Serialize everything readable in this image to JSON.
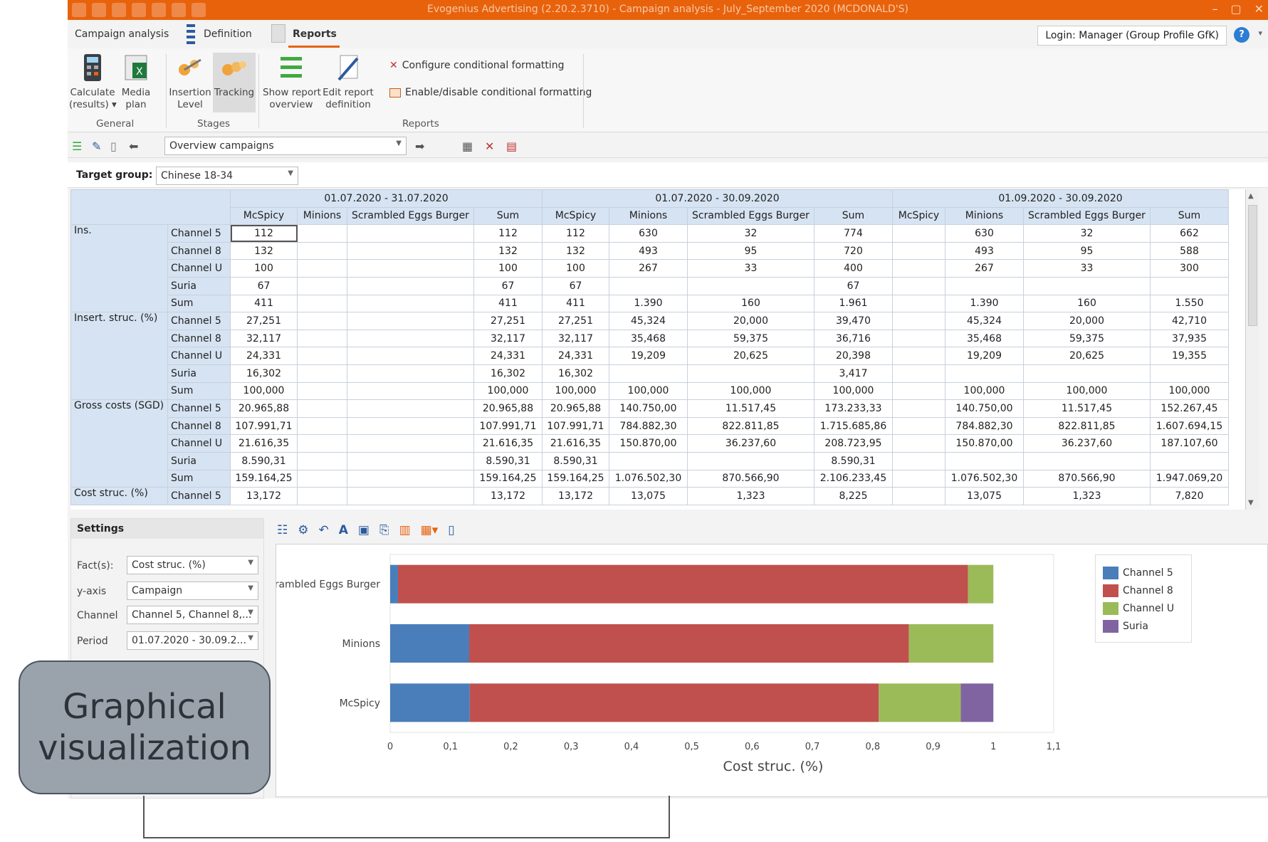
{
  "window": {
    "title": "Evogenius Advertising (2.20.2.3710) - Campaign analysis - July_September 2020 (MCDONALD'S)",
    "buttons": [
      "–",
      "▢",
      "✕"
    ]
  },
  "tabs": [
    {
      "label": "Campaign analysis"
    },
    {
      "label": "Definition"
    },
    {
      "label": "Reports"
    }
  ],
  "login": "Login: Manager (Group Profile GfK)",
  "help": "?",
  "ribbon": {
    "general": {
      "label": "General",
      "calculate": "Calculate\n(results) ▾",
      "media_plan": "Media\nplan"
    },
    "stages": {
      "label": "Stages",
      "insertion": "Insertion\nLevel",
      "tracking": "Tracking"
    },
    "reports": {
      "label": "Reports",
      "show_overview": "Show report\noverview",
      "edit_definition": "Edit report\ndefinition",
      "configure_cf": "Configure conditional formatting",
      "toggle_cf": "Enable/disable conditional formatting"
    }
  },
  "toolbar": {
    "report_select": "Overview campaigns"
  },
  "target_group": {
    "label": "Target group:",
    "value": "Chinese 18-34"
  },
  "grid": {
    "periods": [
      "01.07.2020 - 31.07.2020",
      "01.07.2020 - 30.09.2020",
      "01.09.2020 - 30.09.2020"
    ],
    "columns": [
      "McSpicy",
      "Minions",
      "Scrambled Eggs Burger",
      "Sum"
    ],
    "groups": [
      {
        "name": "Ins.",
        "rows": [
          {
            "ch": "Channel 5",
            "v": [
              "112",
              "",
              "",
              "112",
              "112",
              "630",
              "32",
              "774",
              "",
              "630",
              "32",
              "662"
            ]
          },
          {
            "ch": "Channel 8",
            "v": [
              "132",
              "",
              "",
              "132",
              "132",
              "493",
              "95",
              "720",
              "",
              "493",
              "95",
              "588"
            ]
          },
          {
            "ch": "Channel U",
            "v": [
              "100",
              "",
              "",
              "100",
              "100",
              "267",
              "33",
              "400",
              "",
              "267",
              "33",
              "300"
            ]
          },
          {
            "ch": "Suria",
            "v": [
              "67",
              "",
              "",
              "67",
              "67",
              "",
              "",
              "67",
              "",
              "",
              "",
              ""
            ]
          },
          {
            "ch": "Sum",
            "v": [
              "411",
              "",
              "",
              "411",
              "411",
              "1.390",
              "160",
              "1.961",
              "",
              "1.390",
              "160",
              "1.550"
            ]
          }
        ]
      },
      {
        "name": "Insert. struc. (%)",
        "rows": [
          {
            "ch": "Channel 5",
            "v": [
              "27,251",
              "",
              "",
              "27,251",
              "27,251",
              "45,324",
              "20,000",
              "39,470",
              "",
              "45,324",
              "20,000",
              "42,710"
            ]
          },
          {
            "ch": "Channel 8",
            "v": [
              "32,117",
              "",
              "",
              "32,117",
              "32,117",
              "35,468",
              "59,375",
              "36,716",
              "",
              "35,468",
              "59,375",
              "37,935"
            ]
          },
          {
            "ch": "Channel U",
            "v": [
              "24,331",
              "",
              "",
              "24,331",
              "24,331",
              "19,209",
              "20,625",
              "20,398",
              "",
              "19,209",
              "20,625",
              "19,355"
            ]
          },
          {
            "ch": "Suria",
            "v": [
              "16,302",
              "",
              "",
              "16,302",
              "16,302",
              "",
              "",
              "3,417",
              "",
              "",
              "",
              ""
            ]
          },
          {
            "ch": "Sum",
            "v": [
              "100,000",
              "",
              "",
              "100,000",
              "100,000",
              "100,000",
              "100,000",
              "100,000",
              "",
              "100,000",
              "100,000",
              "100,000"
            ]
          }
        ]
      },
      {
        "name": "Gross costs (SGD)",
        "rows": [
          {
            "ch": "Channel 5",
            "v": [
              "20.965,88",
              "",
              "",
              "20.965,88",
              "20.965,88",
              "140.750,00",
              "11.517,45",
              "173.233,33",
              "",
              "140.750,00",
              "11.517,45",
              "152.267,45"
            ]
          },
          {
            "ch": "Channel 8",
            "v": [
              "107.991,71",
              "",
              "",
              "107.991,71",
              "107.991,71",
              "784.882,30",
              "822.811,85",
              "1.715.685,86",
              "",
              "784.882,30",
              "822.811,85",
              "1.607.694,15"
            ]
          },
          {
            "ch": "Channel U",
            "v": [
              "21.616,35",
              "",
              "",
              "21.616,35",
              "21.616,35",
              "150.870,00",
              "36.237,60",
              "208.723,95",
              "",
              "150.870,00",
              "36.237,60",
              "187.107,60"
            ]
          },
          {
            "ch": "Suria",
            "v": [
              "8.590,31",
              "",
              "",
              "8.590,31",
              "8.590,31",
              "",
              "",
              "8.590,31",
              "",
              "",
              "",
              ""
            ]
          },
          {
            "ch": "Sum",
            "v": [
              "159.164,25",
              "",
              "",
              "159.164,25",
              "159.164,25",
              "1.076.502,30",
              "870.566,90",
              "2.106.233,45",
              "",
              "1.076.502,30",
              "870.566,90",
              "1.947.069,20"
            ]
          }
        ]
      },
      {
        "name": "Cost struc. (%)",
        "rows": [
          {
            "ch": "Channel 5",
            "v": [
              "13,172",
              "",
              "",
              "13,172",
              "13,172",
              "13,075",
              "1,323",
              "8,225",
              "",
              "13,075",
              "1,323",
              "7,820"
            ]
          }
        ]
      }
    ]
  },
  "settings": {
    "title": "Settings",
    "facts_label": "Fact(s):",
    "facts_value": "Cost struc. (%)",
    "yaxis_label": "y-axis",
    "yaxis_value": "Campaign",
    "channel_label": "Channel",
    "channel_value": "Channel 5, Channel 8,...",
    "period_label": "Period",
    "period_value": "01.07.2020 - 30.09.2..."
  },
  "callout": "Graphical visualization",
  "chart_data": {
    "type": "bar",
    "orientation": "horizontal",
    "stacked": true,
    "categories": [
      "Scrambled Eggs Burger",
      "Minions",
      "McSpicy"
    ],
    "series": [
      {
        "name": "Channel 5",
        "color": "#4a7ebb",
        "values": [
          0.013,
          0.131,
          0.132
        ]
      },
      {
        "name": "Channel 8",
        "color": "#c0504d",
        "values": [
          0.945,
          0.729,
          0.678
        ]
      },
      {
        "name": "Channel U",
        "color": "#9bbb59",
        "values": [
          0.042,
          0.14,
          0.136
        ]
      },
      {
        "name": "Suria",
        "color": "#8064a2",
        "values": [
          0,
          0,
          0.054
        ]
      }
    ],
    "xlabel": "Cost struc. (%)",
    "xlim": [
      0,
      1.1
    ],
    "xticks": [
      "0",
      "0,1",
      "0,2",
      "0,3",
      "0,4",
      "0,5",
      "0,6",
      "0,7",
      "0,8",
      "0,9",
      "1",
      "1,1"
    ],
    "legend": "right",
    "grid": false
  }
}
